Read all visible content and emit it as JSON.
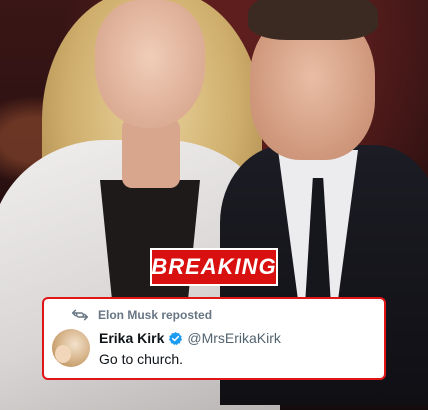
{
  "badge": {
    "text": "BREAKING"
  },
  "tweet": {
    "repost_label": "Elon Musk reposted",
    "display_name": "Erika Kirk",
    "handle": "@MrsErikaKirk",
    "text": "Go to church."
  },
  "icons": {
    "repost": "repost-icon",
    "verified": "verified-badge-icon",
    "avatar": "avatar-photo"
  },
  "colors": {
    "badge_bg": "#d91010",
    "card_border": "#e01515",
    "verified": "#1d9bf0"
  }
}
